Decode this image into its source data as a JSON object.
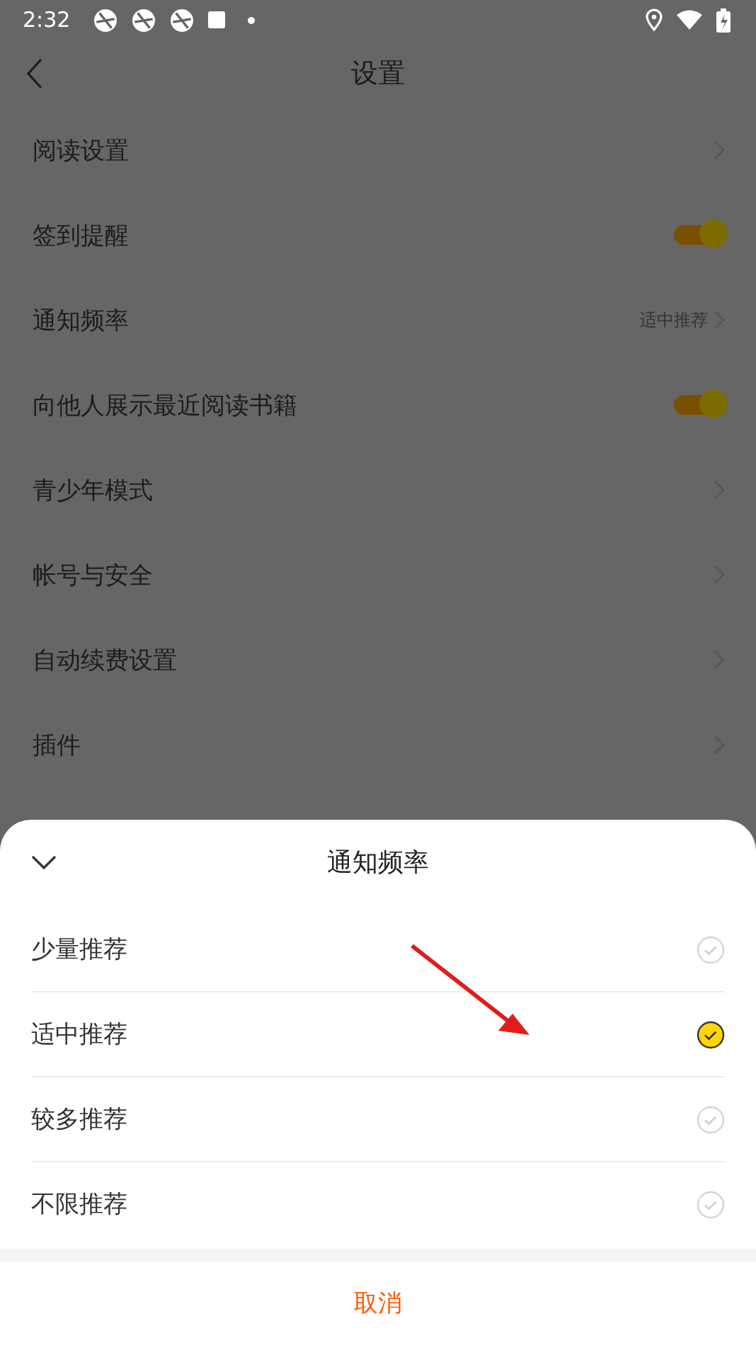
{
  "status_bar": {
    "time": "2:32"
  },
  "header": {
    "title": "设置"
  },
  "settings": [
    {
      "kind": "link",
      "label": "阅读设置"
    },
    {
      "kind": "toggle",
      "label": "签到提醒",
      "on": true
    },
    {
      "kind": "link",
      "label": "通知频率",
      "value": "适中推荐"
    },
    {
      "kind": "toggle",
      "label": "向他人展示最近阅读书籍",
      "on": true
    },
    {
      "kind": "link",
      "label": "青少年模式"
    },
    {
      "kind": "link",
      "label": "帐号与安全"
    },
    {
      "kind": "link",
      "label": "自动续费设置"
    },
    {
      "kind": "link",
      "label": "插件"
    }
  ],
  "sheet": {
    "title": "通知频率",
    "options": [
      {
        "label": "少量推荐",
        "selected": false
      },
      {
        "label": "适中推荐",
        "selected": true
      },
      {
        "label": "较多推荐",
        "selected": false
      },
      {
        "label": "不限推荐",
        "selected": false
      }
    ],
    "cancel": "取消"
  }
}
